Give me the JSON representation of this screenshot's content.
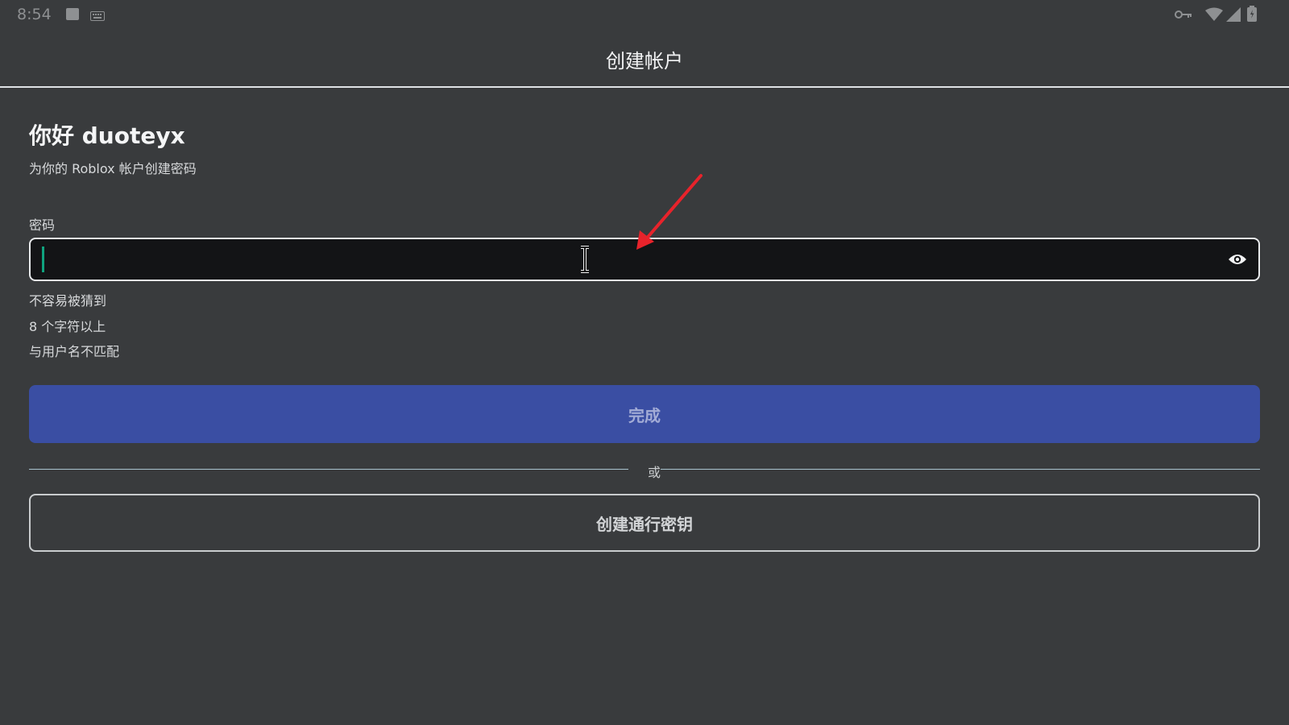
{
  "status_bar": {
    "time": "8:54",
    "icons": [
      "notification-square-icon",
      "keyboard-icon",
      "vpn-key-icon",
      "wifi-icon",
      "signal-icon",
      "battery-icon"
    ]
  },
  "header": {
    "title": "创建帐户"
  },
  "main": {
    "greeting": "你好 duoteyx",
    "subtitle": "为你的 Roblox 帐户创建密码",
    "password_label": "密码",
    "password_value": "",
    "hints": [
      "不容易被猜到",
      "8 个字符以上",
      "与用户名不匹配"
    ],
    "done_label": "完成",
    "or_label": "或",
    "passkey_label": "创建通行密钥"
  },
  "colors": {
    "background": "#393b3d",
    "primary_button": "#3a4ea3",
    "caret": "#0fa37f",
    "annotation_arrow": "#e8232b"
  }
}
